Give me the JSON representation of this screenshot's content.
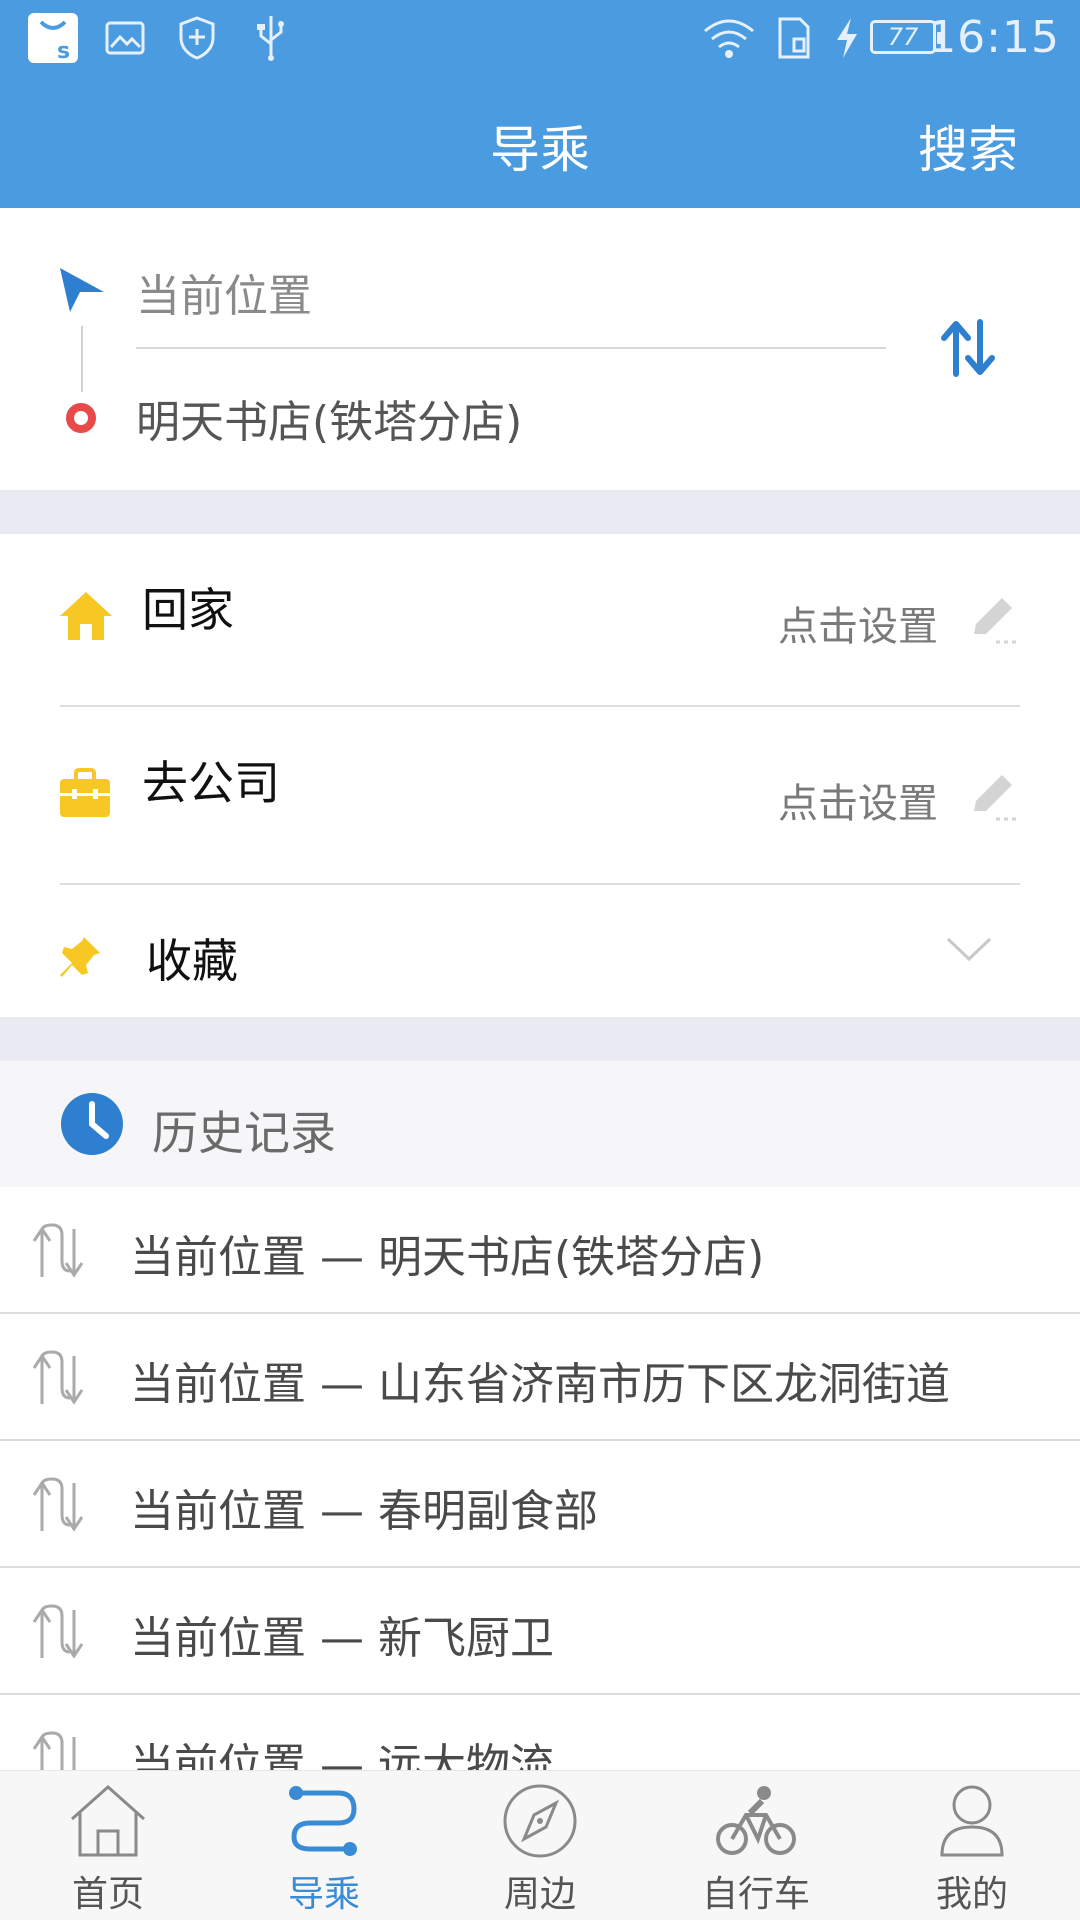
{
  "status_bar": {
    "time": "16:15",
    "battery": "77",
    "icons": [
      "app-store-icon",
      "image-icon",
      "shield-plus-icon",
      "usb-icon",
      "wifi-icon",
      "sim-icon",
      "charging-icon",
      "battery-icon"
    ]
  },
  "header": {
    "title": "导乘",
    "search_label": "搜索",
    "background_color": "#4a9be0"
  },
  "route": {
    "start": "当前位置",
    "end": "明天书店(铁塔分店)"
  },
  "shortcuts": [
    {
      "label": "回家",
      "hint": "点击设置",
      "icon": "home-icon"
    },
    {
      "label": "去公司",
      "hint": "点击设置",
      "icon": "briefcase-icon"
    },
    {
      "label": "收藏",
      "icon": "pin-icon"
    }
  ],
  "history": {
    "title": "历史记录",
    "items": [
      "当前位置 — 明天书店(铁塔分店)",
      "当前位置 — 山东省济南市历下区龙洞街道",
      "当前位置 — 春明副食部",
      "当前位置 — 新飞厨卫",
      "当前位置 — 远大物流"
    ]
  },
  "bottom_nav": [
    {
      "label": "首页",
      "icon": "home-outline-icon"
    },
    {
      "label": "导乘",
      "icon": "route-icon",
      "active": true
    },
    {
      "label": "周边",
      "icon": "compass-icon"
    },
    {
      "label": "自行车",
      "icon": "bicycle-icon"
    },
    {
      "label": "我的",
      "icon": "user-icon"
    }
  ],
  "colors": {
    "accent": "#3a8bd6",
    "start_marker": "#2f7fd0",
    "end_marker": "#e84a4a",
    "shortcut_icon": "#f7c823"
  }
}
